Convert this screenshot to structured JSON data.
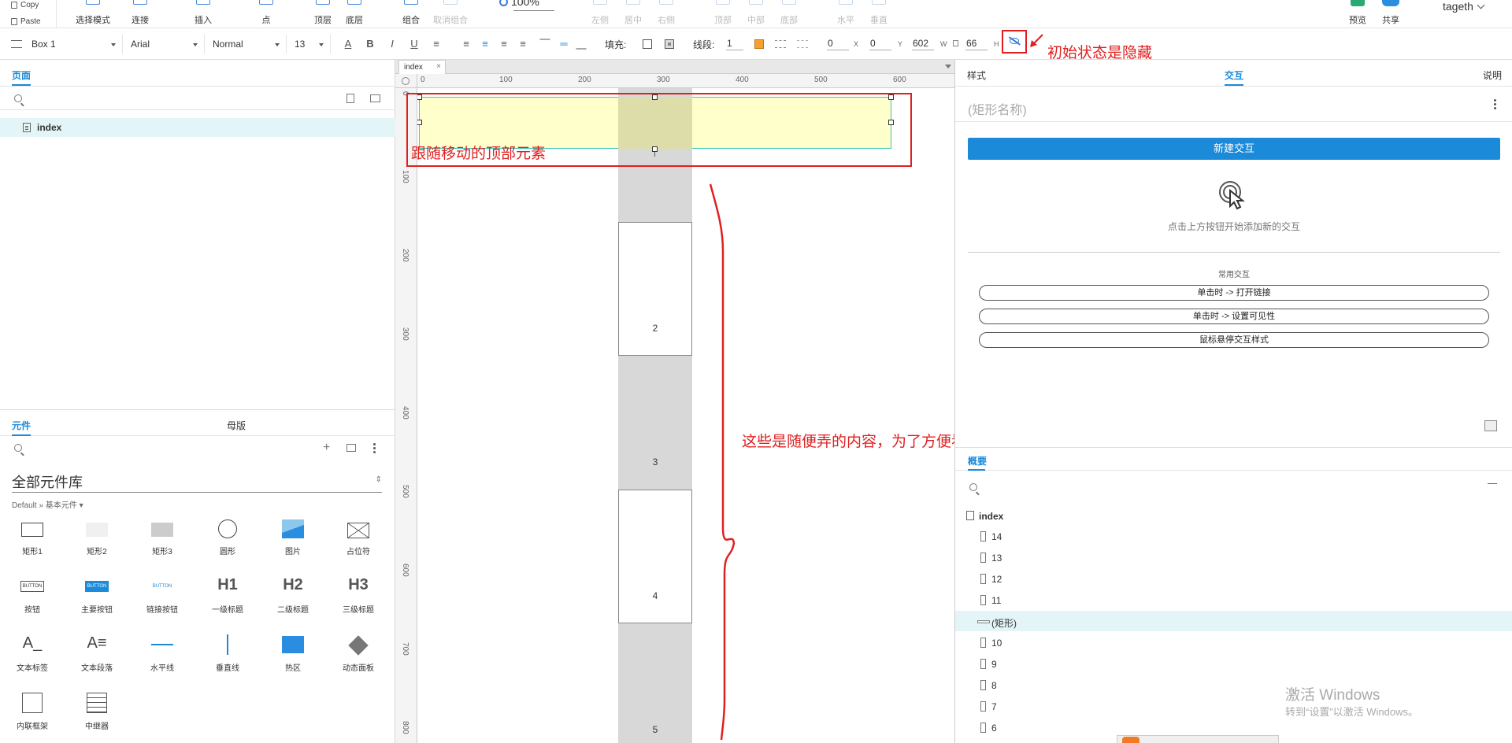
{
  "toolbar": {
    "copy": "Copy",
    "paste": "Paste",
    "tools": [
      {
        "label": "选择模式",
        "disabled": false
      },
      {
        "label": "连接",
        "disabled": false
      },
      {
        "label": "插入",
        "disabled": false
      },
      {
        "label": "点",
        "disabled": false
      },
      {
        "label": "顶层",
        "disabled": false
      },
      {
        "label": "底层",
        "disabled": false
      },
      {
        "label": "组合",
        "disabled": false
      },
      {
        "label": "取消组合",
        "disabled": true
      },
      {
        "label": "左侧",
        "disabled": true
      },
      {
        "label": "居中",
        "disabled": true
      },
      {
        "label": "右侧",
        "disabled": true
      },
      {
        "label": "顶部",
        "disabled": true
      },
      {
        "label": "中部",
        "disabled": true
      },
      {
        "label": "底部",
        "disabled": true
      },
      {
        "label": "水平",
        "disabled": true
      },
      {
        "label": "垂直",
        "disabled": true
      }
    ],
    "zoom": "100%",
    "preview": "预览",
    "share": "共享",
    "user": "tageth"
  },
  "format": {
    "style_name": "Box 1",
    "font": "Arial",
    "weight": "Normal",
    "size": "13",
    "fill_label": "填充:",
    "line_label": "线段:",
    "line_width": "1",
    "x": "0",
    "y": "0",
    "w": "602",
    "h": "66",
    "x_label": "X",
    "y_label": "Y",
    "w_label": "W",
    "h_label": "H",
    "fill_color": "#ffffff",
    "line_color": "#f5a030"
  },
  "annotations": {
    "hidden_initially": "初始状态是隐藏",
    "top_follow": "跟随移动的顶部元素",
    "scroll_content": "这些是随便弄的内容，为了方便看滚动的效果"
  },
  "left": {
    "pages_tab": "页面",
    "page_item": "index",
    "widgets_tab": "元件",
    "masters_tab": "母版",
    "library": "全部元件库",
    "library_sub": "Default » 基本元件 ▾",
    "widgets": [
      {
        "label": "矩形1",
        "icon": "rect-outline-icon"
      },
      {
        "label": "矩形2",
        "icon": "rect-light-icon"
      },
      {
        "label": "矩形3",
        "icon": "rect-gray-icon"
      },
      {
        "label": "圆形",
        "icon": "circle-icon"
      },
      {
        "label": "图片",
        "icon": "image-icon"
      },
      {
        "label": "占位符",
        "icon": "placeholder-icon"
      },
      {
        "label": "按钮",
        "icon": "button-icon"
      },
      {
        "label": "主要按钮",
        "icon": "primary-button-icon"
      },
      {
        "label": "链接按钮",
        "icon": "link-button-icon"
      },
      {
        "label": "一级标题",
        "icon": "h1-icon"
      },
      {
        "label": "二级标题",
        "icon": "h2-icon"
      },
      {
        "label": "三级标题",
        "icon": "h3-icon"
      },
      {
        "label": "文本标签",
        "icon": "text-label-icon"
      },
      {
        "label": "文本段落",
        "icon": "text-paragraph-icon"
      },
      {
        "label": "水平线",
        "icon": "horizontal-line-icon"
      },
      {
        "label": "垂直线",
        "icon": "vertical-line-icon"
      },
      {
        "label": "热区",
        "icon": "hotspot-icon"
      },
      {
        "label": "动态面板",
        "icon": "dynamic-panel-icon"
      },
      {
        "label": "内联框架",
        "icon": "inline-frame-icon"
      },
      {
        "label": "中继器",
        "icon": "repeater-icon"
      }
    ],
    "widget_text": {
      "button": "BUTTON",
      "h1": "H1",
      "h2": "H2",
      "h3": "H3"
    }
  },
  "canvas": {
    "tab": "index",
    "ruler_h": [
      "0",
      "100",
      "200",
      "300",
      "400",
      "500",
      "600"
    ],
    "ruler_v": [
      "0",
      "100",
      "200",
      "300",
      "400",
      "500",
      "600",
      "700",
      "800"
    ],
    "boxes": [
      "2",
      "3",
      "4",
      "5"
    ]
  },
  "right": {
    "tab_style": "样式",
    "tab_interact": "交互",
    "tab_notes": "说明",
    "shape_name": "(矩形名称)",
    "new_interaction": "新建交互",
    "hint": "点击上方按钮开始添加新的交互",
    "common": "常用交互",
    "pills": [
      "单击时 -> 打开链接",
      "单击时 -> 设置可见性",
      "鼠标悬停交互样式"
    ],
    "outline_tab": "概要",
    "tree": [
      {
        "label": "index",
        "type": "page"
      },
      {
        "label": "14",
        "type": "item"
      },
      {
        "label": "13",
        "type": "item"
      },
      {
        "label": "12",
        "type": "item"
      },
      {
        "label": "11",
        "type": "item"
      },
      {
        "label": "(矩形)",
        "type": "selected"
      },
      {
        "label": "10",
        "type": "item"
      },
      {
        "label": "9",
        "type": "item"
      },
      {
        "label": "8",
        "type": "item"
      },
      {
        "label": "7",
        "type": "item"
      },
      {
        "label": "6",
        "type": "item"
      }
    ]
  },
  "watermark": {
    "line1": "激活 Windows",
    "line2": "转到“设置”以激活 Windows。"
  }
}
